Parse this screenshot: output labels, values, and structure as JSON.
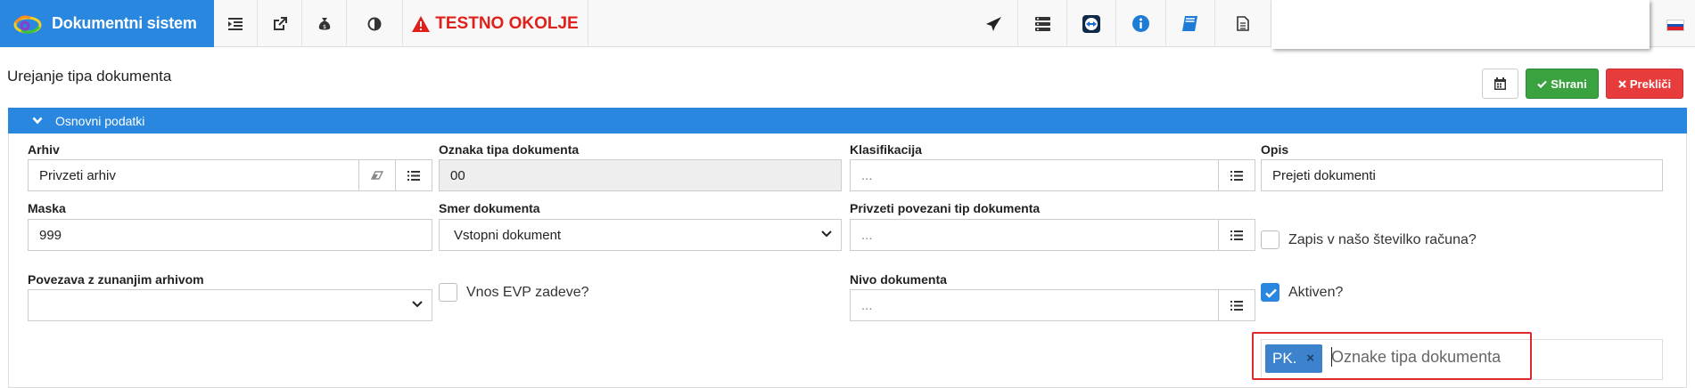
{
  "app": {
    "title": "Dokumentni sistem"
  },
  "env": {
    "label": "TESTNO OKOLJE"
  },
  "page": {
    "title": "Urejanje tipa dokumenta"
  },
  "actions": {
    "save_label": "Shrani",
    "cancel_label": "Prekliči"
  },
  "panel": {
    "title": "Osnovni podatki"
  },
  "fields": {
    "arhiv": {
      "label": "Arhiv",
      "value": "Privzeti arhiv"
    },
    "oznaka": {
      "label": "Oznaka tipa dokumenta",
      "value": "00"
    },
    "klasifikacija": {
      "label": "Klasifikacija",
      "placeholder": "..."
    },
    "opis": {
      "label": "Opis",
      "value": "Prejeti dokumenti"
    },
    "maska": {
      "label": "Maska",
      "value": "999"
    },
    "smer": {
      "label": "Smer dokumenta",
      "value": "Vstopni dokument"
    },
    "povezani": {
      "label": "Privzeti povezani tip dokumenta",
      "placeholder": "..."
    },
    "zapis": {
      "label": "Zapis v našo številko računa?",
      "checked": false
    },
    "povezava": {
      "label": "Povezava z zunanjim arhivom",
      "value": ""
    },
    "evp": {
      "label": "Vnos EVP zadeve?",
      "checked": false
    },
    "nivo": {
      "label": "Nivo dokumenta",
      "placeholder": "..."
    },
    "aktiven": {
      "label": "Aktiven?",
      "checked": true
    },
    "oznake": {
      "tags": [
        "PK."
      ],
      "placeholder": "Oznake tipa dokumenta"
    }
  },
  "colors": {
    "primary": "#2a87e0",
    "success": "#3aa33f",
    "danger": "#e83b3b",
    "env": "#e0201a"
  },
  "icons": [
    "logo-icon",
    "indent-icon",
    "external-link-icon",
    "money-bag-icon",
    "contrast-icon",
    "warning-icon",
    "paper-plane-icon",
    "server-icon",
    "teamviewer-icon",
    "info-icon",
    "book-icon",
    "document-icon",
    "slovenia-flag-icon"
  ]
}
